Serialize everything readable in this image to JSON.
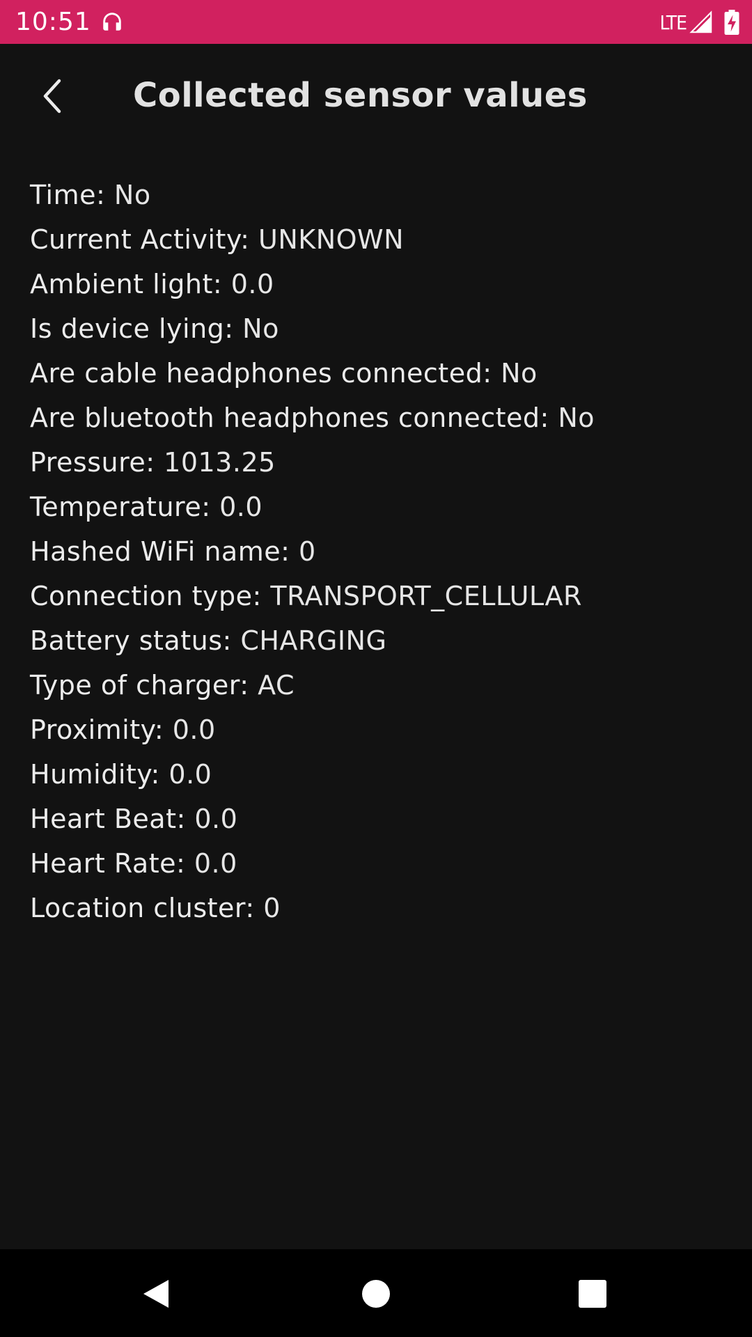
{
  "status_bar": {
    "time": "10:51",
    "network": "LTE",
    "icons": [
      "headphones-icon",
      "signal-icon",
      "battery-charging-icon"
    ],
    "background_color": "#d1215f"
  },
  "app_bar": {
    "back_icon": "chevron-left-icon",
    "title": "Collected sensor values"
  },
  "sensors": [
    {
      "label": "Time: ",
      "value": "No"
    },
    {
      "label": "Current Activity: ",
      "value": "UNKNOWN"
    },
    {
      "label": "Ambient light: ",
      "value": "0.0"
    },
    {
      "label": "Is device lying: ",
      "value": "No"
    },
    {
      "label": "Are cable headphones connected: ",
      "value": "No"
    },
    {
      "label": "Are bluetooth headphones connected: ",
      "value": "No"
    },
    {
      "label": "Pressure: ",
      "value": "1013.25"
    },
    {
      "label": "Temperature: ",
      "value": "0.0"
    },
    {
      "label": "Hashed WiFi name: ",
      "value": "0"
    },
    {
      "label": "Connection type: ",
      "value": "TRANSPORT_CELLULAR"
    },
    {
      "label": "Battery status: ",
      "value": "CHARGING"
    },
    {
      "label": "Type of charger: ",
      "value": "AC"
    },
    {
      "label": "Proximity: ",
      "value": "0.0"
    },
    {
      "label": "Humidity: ",
      "value": "0.0"
    },
    {
      "label": "Heart Beat: ",
      "value": "0.0"
    },
    {
      "label": "Heart Rate: ",
      "value": "0.0"
    },
    {
      "label": "Location cluster: ",
      "value": "0"
    }
  ],
  "nav_bar": {
    "icons": [
      "nav-back-icon",
      "nav-home-icon",
      "nav-recents-icon"
    ]
  }
}
